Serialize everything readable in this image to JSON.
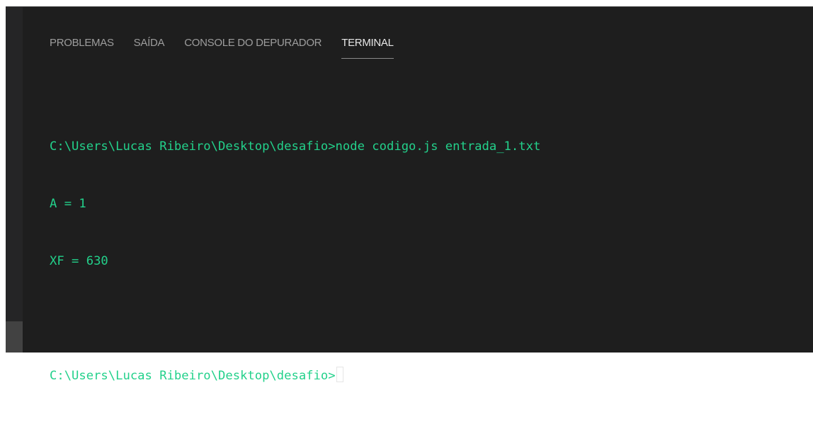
{
  "panel": {
    "tabs": [
      {
        "label": "PROBLEMAS",
        "active": false
      },
      {
        "label": "SAÍDA",
        "active": false
      },
      {
        "label": "CONSOLE DO DEPURADOR",
        "active": false
      },
      {
        "label": "TERMINAL",
        "active": true
      }
    ]
  },
  "terminal": {
    "lines": [
      "C:\\Users\\Lucas Ribeiro\\Desktop\\desafio>node codigo.js entrada_1.txt",
      "A = 1",
      "XF = 630",
      "",
      "C:\\Users\\Lucas Ribeiro\\Desktop\\desafio>"
    ]
  },
  "colors": {
    "background": "#1e1e1e",
    "terminal_text": "#23d18b",
    "tab_active": "#e7e7e7",
    "tab_inactive": "#9d9d9d"
  }
}
